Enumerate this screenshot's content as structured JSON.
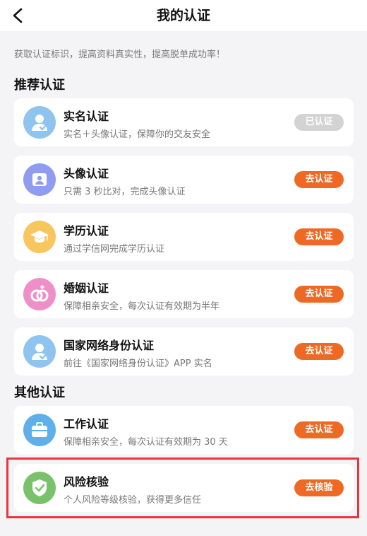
{
  "header": {
    "title": "我的认证",
    "back_icon": "chevron-left-icon"
  },
  "tip": "获取认证标识，提高资料真实性，提高脱单成功率！",
  "sections": {
    "recommended": "推荐认证",
    "other": "其他认证"
  },
  "items": [
    {
      "title": "实名认证",
      "subtitle": "实名＋头像认证，保障你的交友安全",
      "button": "已认证",
      "icon": "person-check-icon",
      "icon_color": "#8fc4ef",
      "status": "verified"
    },
    {
      "title": "头像认证",
      "subtitle": "只需 3 秒比对，完成头像认证",
      "button": "去认证",
      "icon": "portrait-frame-icon",
      "icon_color": "#8f9cf0",
      "status": "pending"
    },
    {
      "title": "学历认证",
      "subtitle": "通过学信网完成学历认证",
      "button": "去认证",
      "icon": "graduation-cap-icon",
      "icon_color": "#f7c65e",
      "status": "pending"
    },
    {
      "title": "婚姻认证",
      "subtitle": "保障相亲安全，每次认证有效期为半年",
      "button": "去认证",
      "icon": "rings-icon",
      "icon_color": "#ef8fc8",
      "status": "pending"
    },
    {
      "title": "国家网络身份认证",
      "subtitle": "前往《国家网络身份认证》APP 实名",
      "button": "去认证",
      "icon": "person-check-icon",
      "icon_color": "#8fc4ef",
      "status": "pending"
    },
    {
      "title": "工作认证",
      "subtitle": "保障相亲安全，每次认证有效期为 30 天",
      "button": "去认证",
      "icon": "briefcase-icon",
      "icon_color": "#5fb0ea",
      "status": "pending"
    },
    {
      "title": "风险核验",
      "subtitle": "个人风险等级核验，获得更多信任",
      "button": "去核验",
      "icon": "shield-check-icon",
      "icon_color": "#79c26b",
      "status": "pending"
    }
  ],
  "colors": {
    "accent": "#ee6a24",
    "verified_button": "#d3d3d3",
    "highlight_border": "#e8363c"
  }
}
